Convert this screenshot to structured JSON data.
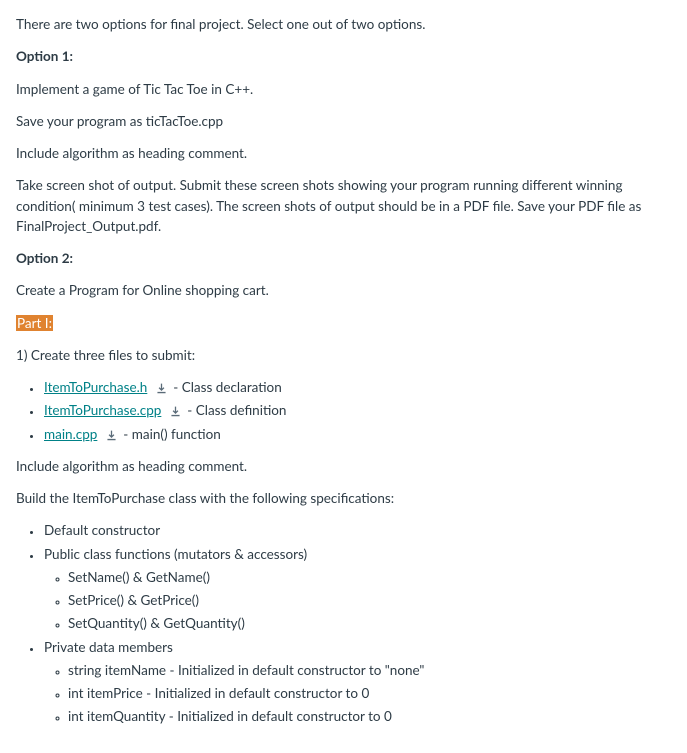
{
  "intro": "There are two options for final project. Select one out of two options.",
  "option1": {
    "heading": "Option 1:",
    "line1": "Implement a game of Tic Tac Toe in C++.",
    "line2": "Save your program as ticTacToe.cpp",
    "line3": "Include algorithm as heading comment.",
    "line4": "Take screen shot of output. Submit these screen shots showing your program running different winning condition( minimum 3 test cases). The screen shots of output should be in a PDF file. Save your PDF file as FinalProject_Output.pdf."
  },
  "option2": {
    "heading": "Option 2:",
    "line1": "Create a Program for Online shopping cart.",
    "partLabel": "Part I:",
    "createFiles": "1) Create three files to submit:",
    "files": [
      {
        "name": "ItemToPurchase.h",
        "desc": " - Class declaration"
      },
      {
        "name": "ItemToPurchase.cpp",
        "desc": " - Class definition"
      },
      {
        "name": "main.cpp",
        "desc": " - main() function"
      }
    ],
    "includeAlgo": "Include algorithm as heading comment.",
    "buildClass": "Build the ItemToPurchase class with the following specifications:",
    "specs": {
      "item1": "Default constructor",
      "item2": "Public class functions (mutators & accessors)",
      "sub2": [
        "SetName() & GetName()",
        "SetPrice() & GetPrice()",
        "SetQuantity() & GetQuantity()"
      ],
      "item3": "Private data members",
      "sub3": [
        "string itemName - Initialized in default constructor to \"none\"",
        "int itemPrice - Initialized in default constructor to 0",
        "int itemQuantity - Initialized in default constructor to 0"
      ]
    }
  }
}
